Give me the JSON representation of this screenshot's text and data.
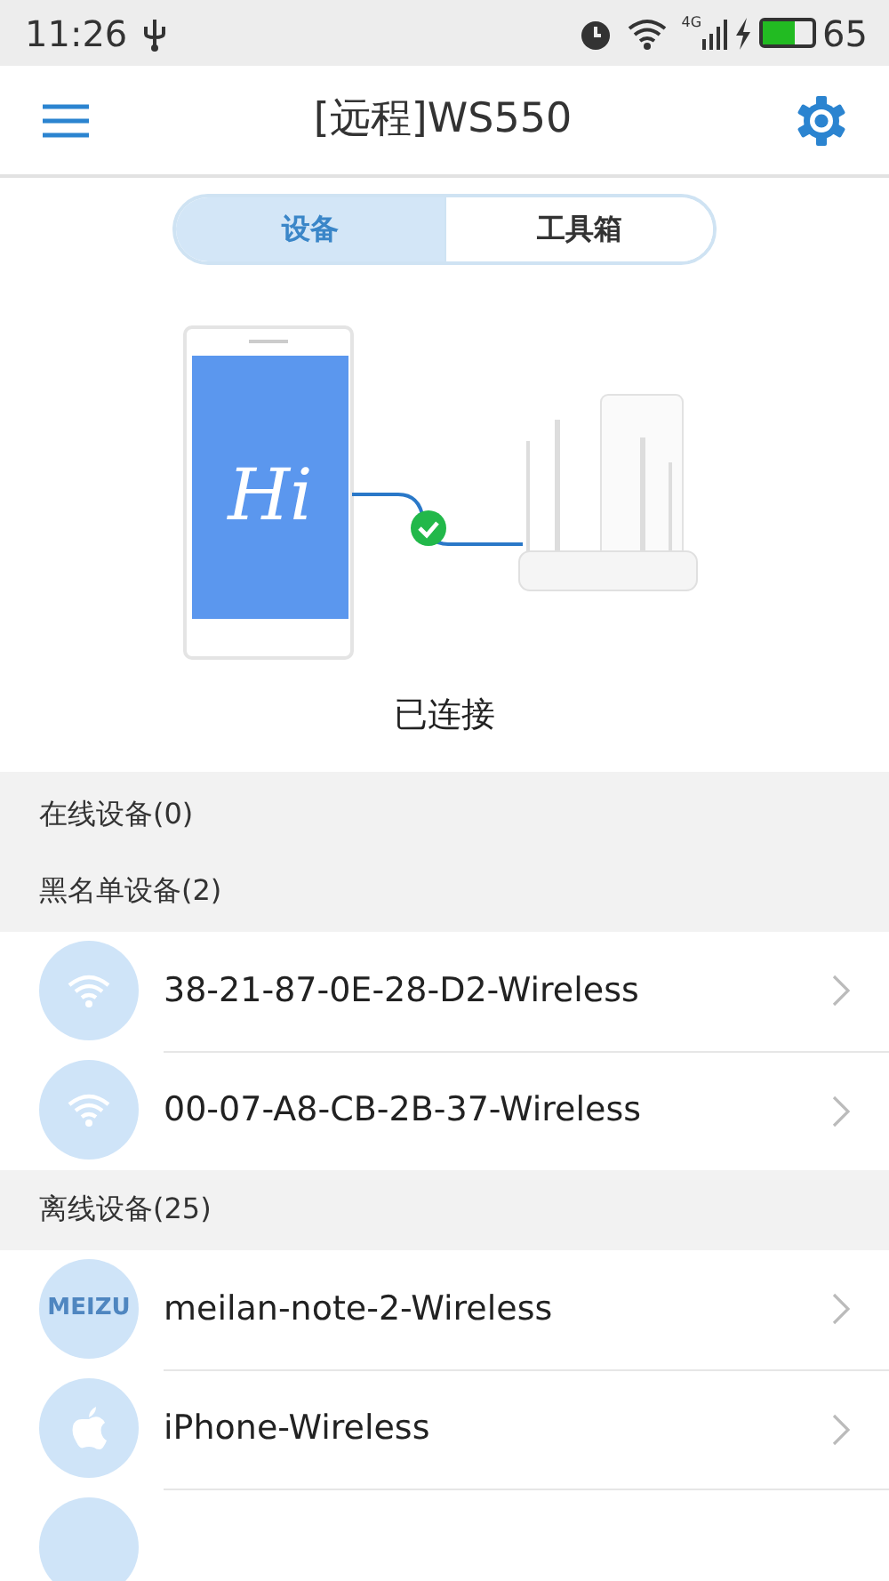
{
  "status_bar": {
    "time": "11:26",
    "network": "4G",
    "battery": {
      "level": 0.65,
      "text": "65"
    }
  },
  "header": {
    "title": "[远程]WS550"
  },
  "tabs": [
    {
      "label": "设备",
      "selected": true
    },
    {
      "label": "工具箱",
      "selected": false
    }
  ],
  "illustration": {
    "phone_logo": "Hi",
    "status": "已连接"
  },
  "sections": [
    {
      "title": "在线设备(0)"
    },
    {
      "title": "黑名单设备(2)",
      "devices": [
        {
          "kind": "wifi",
          "name": "38-21-87-0E-28-D2-Wireless"
        },
        {
          "kind": "wifi",
          "name": "00-07-A8-CB-2B-37-Wireless"
        }
      ]
    },
    {
      "title": "离线设备(25)",
      "devices": [
        {
          "kind": "text",
          "avatar_text": "MEIZU",
          "name": "meilan-note-2-Wireless"
        },
        {
          "kind": "apple",
          "name": "iPhone-Wireless"
        },
        {
          "kind": "blank"
        }
      ]
    }
  ]
}
